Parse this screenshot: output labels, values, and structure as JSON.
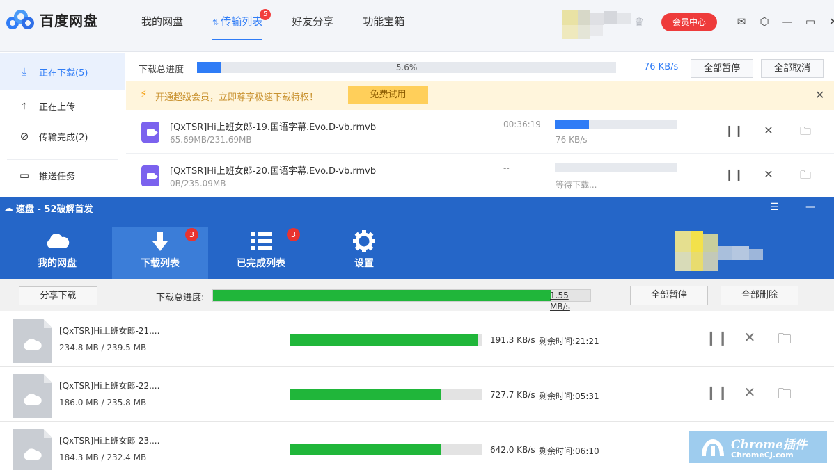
{
  "baidu": {
    "logo_text": "百度网盘",
    "nav": [
      {
        "label": "我的网盘"
      },
      {
        "label": "传输列表",
        "badge": "5",
        "active": true
      },
      {
        "label": "好友分享"
      },
      {
        "label": "功能宝箱"
      }
    ],
    "vip_button": "会员中心",
    "window_icons": [
      "mail-icon",
      "settings-icon",
      "minimize-icon",
      "maximize-icon",
      "close-icon"
    ],
    "sidebar": [
      {
        "icon": "download-icon",
        "label": "正在下载(5)",
        "active": true
      },
      {
        "icon": "upload-icon",
        "label": "正在上传"
      },
      {
        "icon": "check-circle-icon",
        "label": "传输完成(2)"
      },
      {
        "icon": "monitor-icon",
        "label": "推送任务"
      }
    ],
    "total": {
      "label": "下载总进度",
      "percent": "5.6%",
      "progress": 0.056,
      "speed": "76 KB/s",
      "pause_all": "全部暂停",
      "cancel_all": "全部取消"
    },
    "promo": {
      "text": "开通超级会员，立即尊享极速下载特权！",
      "button": "免费试用"
    },
    "downloads": [
      {
        "name": "[QxTSR]Hi上班女郎-19.国语字幕.Evo.D-vb.rmvb",
        "size": "65.69MB/231.69MB",
        "time": "00:36:19",
        "progress": 0.28,
        "status": "76 KB/s"
      },
      {
        "name": "[QxTSR]Hi上班女郎-20.国语字幕.Evo.D-vb.rmvb",
        "size": "0B/235.09MB",
        "time": "--",
        "progress": 0,
        "status": "等待下载..."
      }
    ]
  },
  "sudisk": {
    "title": "速盘 - 52破解首发",
    "tabs": [
      {
        "label": "我的网盘",
        "icon": "cloud-icon"
      },
      {
        "label": "下载列表",
        "icon": "download-arrow-icon",
        "badge": "3",
        "active": true
      },
      {
        "label": "已完成列表",
        "icon": "list-icon",
        "badge": "3"
      },
      {
        "label": "设置",
        "icon": "gear-icon"
      }
    ],
    "share_download": "分享下载",
    "total": {
      "label": "下载总进度:",
      "progress": 0.895,
      "speed": "1.55 MB/s",
      "pause_all": "全部暂停",
      "delete_all": "全部删除"
    },
    "downloads": [
      {
        "name": "[QxTSR]Hi上班女郎-21....",
        "size": "234.8 MB / 239.5 MB",
        "progress": 0.98,
        "speed": "191.3 KB/s",
        "eta": "剩余时间:21:21"
      },
      {
        "name": "[QxTSR]Hi上班女郎-22....",
        "size": "186.0 MB / 235.8 MB",
        "progress": 0.79,
        "speed": "727.7 KB/s",
        "eta": "剩余时间:05:31"
      },
      {
        "name": "[QxTSR]Hi上班女郎-23....",
        "size": "184.3 MB / 232.4 MB",
        "progress": 0.79,
        "speed": "642.0 KB/s",
        "eta": "剩余时间:06:10"
      }
    ]
  },
  "watermark": {
    "line1": "Chrome插件",
    "line2": "ChromeCJ.com"
  },
  "colors": {
    "baidu_blue": "#2f7cf6",
    "sudisk_blue": "#2566c8",
    "progress_green": "#20b63a",
    "badge_red": "#f23d3d"
  }
}
